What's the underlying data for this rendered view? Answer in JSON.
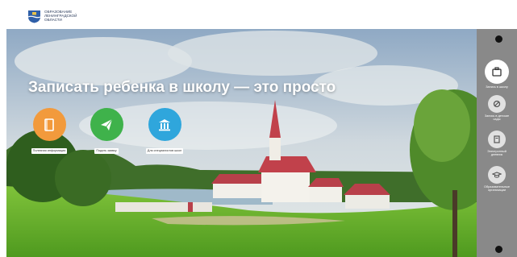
{
  "header": {
    "logo_text": "ОБРАЗОВАНИЕ\nЛЕНИНГРАДСКОЙ\nОБЛАСТИ",
    "logo_icon": "coat-of-arms-icon"
  },
  "hero": {
    "title": "Записать ребенка в школу — это просто",
    "actions": [
      {
        "label": "Полезная информация",
        "icon": "book-icon",
        "color": "#f29a3c"
      },
      {
        "label": "Подать заявку",
        "icon": "send-icon",
        "color": "#3fb24b"
      },
      {
        "label": "Для специалистов школ",
        "icon": "institution-icon",
        "color": "#2fa6dc"
      }
    ]
  },
  "rail": {
    "items": [
      {
        "label": "Запись в школу",
        "icon": "briefcase-icon",
        "active": true
      },
      {
        "label": "Запись в детские\nсады",
        "icon": "pacifier-icon",
        "active": false
      },
      {
        "label": "Электронный\nдневник",
        "icon": "diary-icon",
        "active": false
      },
      {
        "label": "Образовательные\nорганизации",
        "icon": "hat-icon",
        "active": false
      }
    ]
  },
  "colors": {
    "accent_orange": "#f29a3c",
    "accent_green": "#3fb24b",
    "accent_blue": "#2fa6dc"
  }
}
